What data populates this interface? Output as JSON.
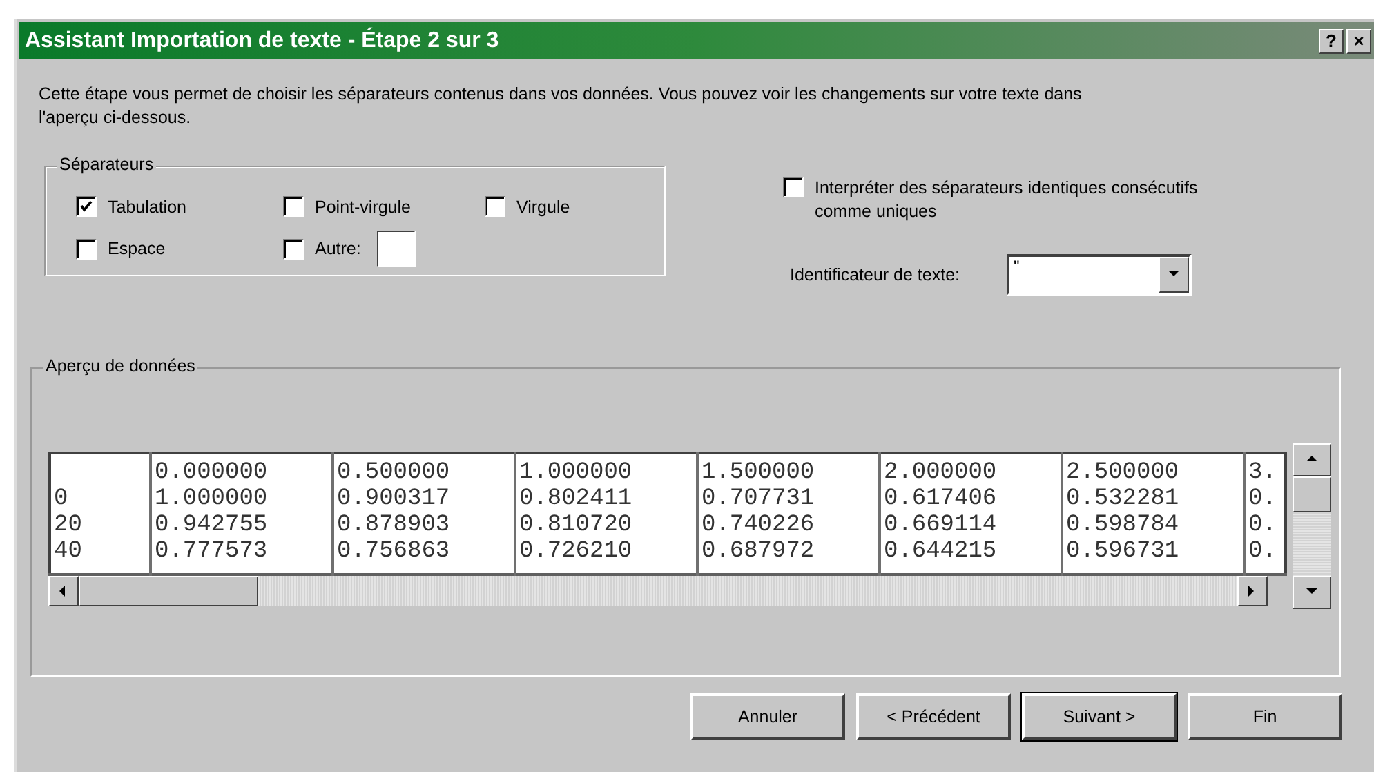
{
  "window": {
    "title": "Assistant Importation de texte - Étape 2 sur 3",
    "help": "?",
    "close": "×"
  },
  "description": "Cette étape vous permet de choisir les séparateurs contenus dans vos données. Vous pouvez voir les changements sur votre texte dans l'aperçu ci-dessous.",
  "separators": {
    "title": "Séparateurs",
    "options": [
      {
        "label": "Tabulation",
        "checked": true
      },
      {
        "label": "Point-virgule",
        "checked": false
      },
      {
        "label": "Virgule",
        "checked": false
      },
      {
        "label": "Espace",
        "checked": false
      },
      {
        "label": "Autre:",
        "checked": false
      }
    ]
  },
  "consecutive": {
    "label": "Interpréter des séparateurs identiques consécutifs comme uniques",
    "checked": false
  },
  "text_qualifier": {
    "label": "Identificateur de texte:",
    "value": "\""
  },
  "preview": {
    "title": "Aperçu de données",
    "rows": [
      [
        "",
        "0.000000",
        "0.500000",
        "1.000000",
        "1.500000",
        "2.000000",
        "2.500000",
        "3."
      ],
      [
        "0",
        "1.000000",
        "0.900317",
        "0.802411",
        "0.707731",
        "0.617406",
        "0.532281",
        "0."
      ],
      [
        "20",
        "0.942755",
        "0.878903",
        "0.810720",
        "0.740226",
        "0.669114",
        "0.598784",
        "0."
      ],
      [
        "40",
        "0.777573",
        "0.756863",
        "0.726210",
        "0.687972",
        "0.644215",
        "0.596731",
        "0."
      ]
    ]
  },
  "buttons": [
    {
      "label": "Annuler",
      "default": false
    },
    {
      "label": "< Précédent",
      "default": false
    },
    {
      "label": "Suivant >",
      "default": true
    },
    {
      "label": "Fin",
      "default": false
    }
  ]
}
